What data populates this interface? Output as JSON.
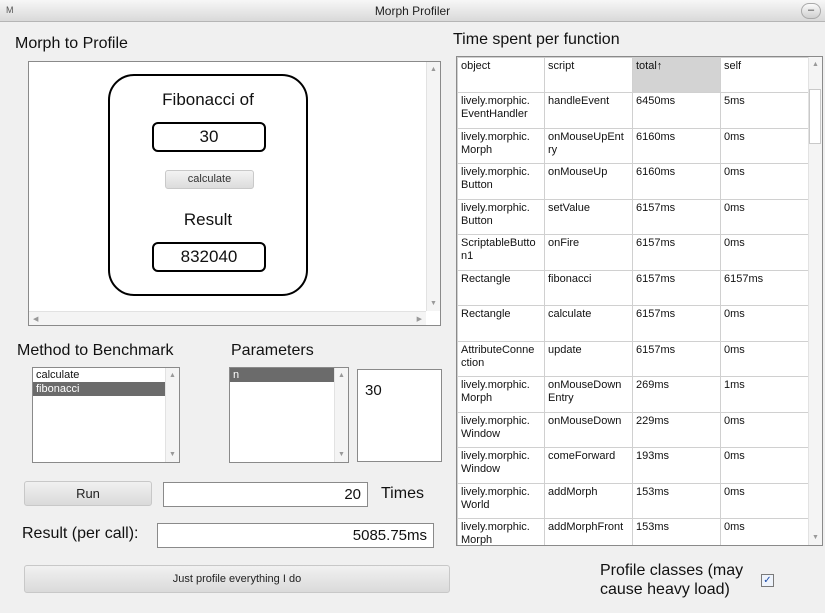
{
  "window": {
    "title": "Morph Profiler",
    "app_icon_text": "M",
    "minimize_label": "–"
  },
  "morph_section": {
    "heading": "Morph to Profile",
    "card": {
      "title": "Fibonacci of",
      "input_value": "30",
      "button_label": "calculate",
      "result_label": "Result",
      "result_value": "832040"
    }
  },
  "benchmark": {
    "method_heading": "Method to Benchmark",
    "methods": [
      {
        "label": "calculate",
        "selected": false
      },
      {
        "label": "fibonacci",
        "selected": true
      }
    ],
    "parameters_heading": "Parameters",
    "parameters": [
      {
        "label": "n",
        "selected": true
      }
    ],
    "parameter_value": "30",
    "run_label": "Run",
    "times_value": "20",
    "times_label": "Times",
    "result_label": "Result (per call):",
    "result_value": "5085.75ms",
    "profile_all_label": "Just profile everything I do"
  },
  "profile_table": {
    "heading": "Time spent per function",
    "columns": [
      "object",
      "script",
      "total↑",
      "self"
    ],
    "sorted_column": 2,
    "rows": [
      [
        "lively.morphic.\nEventHandler",
        "handleEvent",
        "6450ms",
        "5ms"
      ],
      [
        "lively.morphic.\nMorph",
        "onMouseUpEnt\nry",
        "6160ms",
        "0ms"
      ],
      [
        "lively.morphic.\nButton",
        "onMouseUp",
        "6160ms",
        "0ms"
      ],
      [
        "lively.morphic.\nButton",
        "setValue",
        "6157ms",
        "0ms"
      ],
      [
        "ScriptableButto\nn1",
        "onFire",
        "6157ms",
        "0ms"
      ],
      [
        "Rectangle",
        "fibonacci",
        "6157ms",
        "6157ms"
      ],
      [
        "Rectangle",
        "calculate",
        "6157ms",
        "0ms"
      ],
      [
        "AttributeConne\nction",
        "update",
        "6157ms",
        "0ms"
      ],
      [
        "lively.morphic.\nMorph",
        "onMouseDown\nEntry",
        "269ms",
        "1ms"
      ],
      [
        "lively.morphic.\nWindow",
        "onMouseDown",
        "229ms",
        "0ms"
      ],
      [
        "lively.morphic.\nWindow",
        "comeForward",
        "193ms",
        "0ms"
      ],
      [
        "lively.morphic.\nWorld",
        "addMorph",
        "153ms",
        "0ms"
      ],
      [
        "lively.morphic.\nMorph",
        "addMorphFront",
        "153ms",
        "0ms"
      ]
    ]
  },
  "profile_classes": {
    "label": "Profile classes (may\ncause heavy load)",
    "checked": true,
    "check_glyph": "✓"
  }
}
